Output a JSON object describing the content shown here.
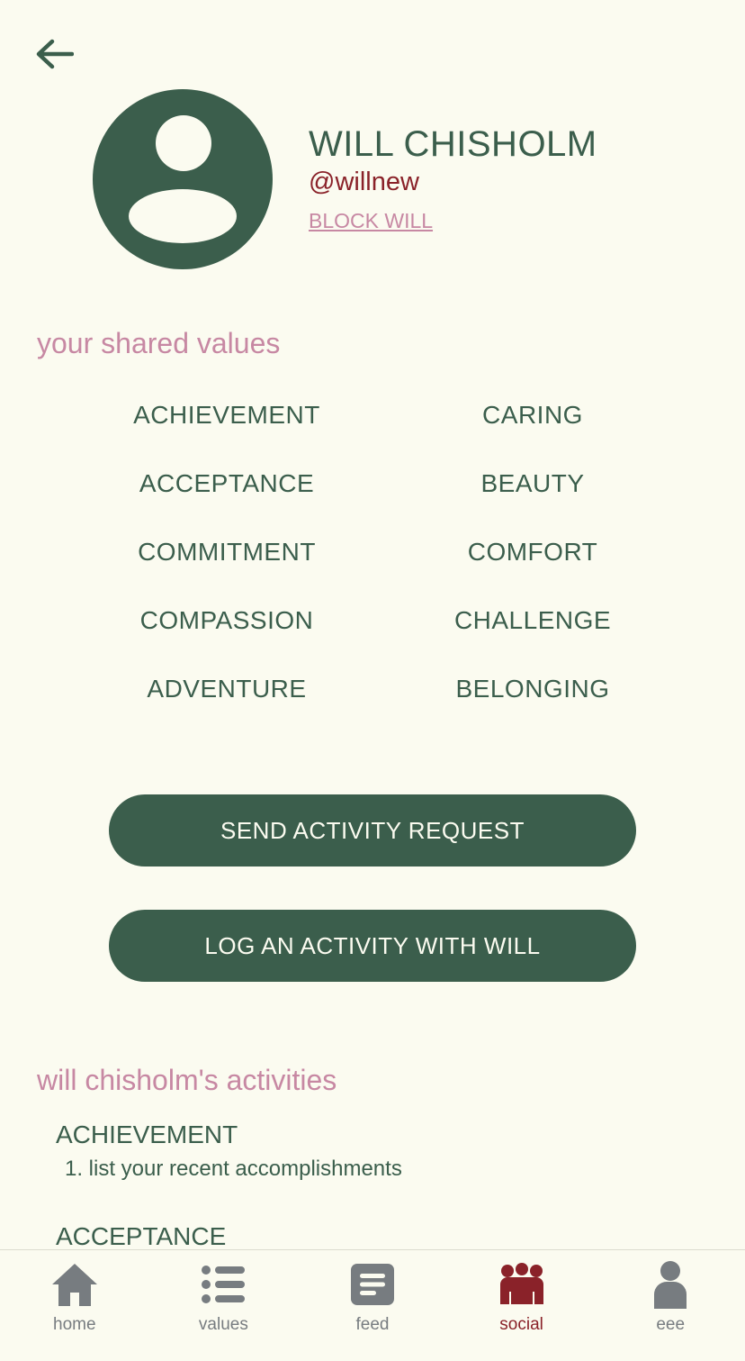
{
  "header": {
    "back_icon": "arrow-left-icon"
  },
  "profile": {
    "avatar_icon": "user-avatar-icon",
    "name": "WILL CHISHOLM",
    "handle": "@willnew",
    "block_label": "BLOCK WILL"
  },
  "shared_values": {
    "title": "your shared values",
    "items": [
      "ACHIEVEMENT",
      "CARING",
      "ACCEPTANCE",
      "BEAUTY",
      "COMMITMENT",
      "COMFORT",
      "COMPASSION",
      "CHALLENGE",
      "ADVENTURE",
      "BELONGING"
    ]
  },
  "actions": {
    "send_request": "SEND ACTIVITY REQUEST",
    "log_activity": "LOG AN ACTIVITY WITH WILL"
  },
  "activities": {
    "title": "will chisholm's activities",
    "groups": [
      {
        "heading": "ACHIEVEMENT",
        "items": [
          "1. list your recent accomplishments"
        ]
      },
      {
        "heading": "ACCEPTANCE",
        "items": []
      }
    ]
  },
  "nav": {
    "items": [
      {
        "label": "home",
        "icon": "home-icon",
        "active": false
      },
      {
        "label": "values",
        "icon": "list-icon",
        "active": false
      },
      {
        "label": "feed",
        "icon": "feed-icon",
        "active": false
      },
      {
        "label": "social",
        "icon": "group-icon",
        "active": true
      },
      {
        "label": "eee",
        "icon": "person-icon",
        "active": false
      }
    ]
  },
  "colors": {
    "background": "#fbfbf0",
    "primary_green": "#3b5e4c",
    "accent_pink": "#c788a3",
    "accent_red": "#8a2229",
    "nav_gray": "#777c80"
  }
}
